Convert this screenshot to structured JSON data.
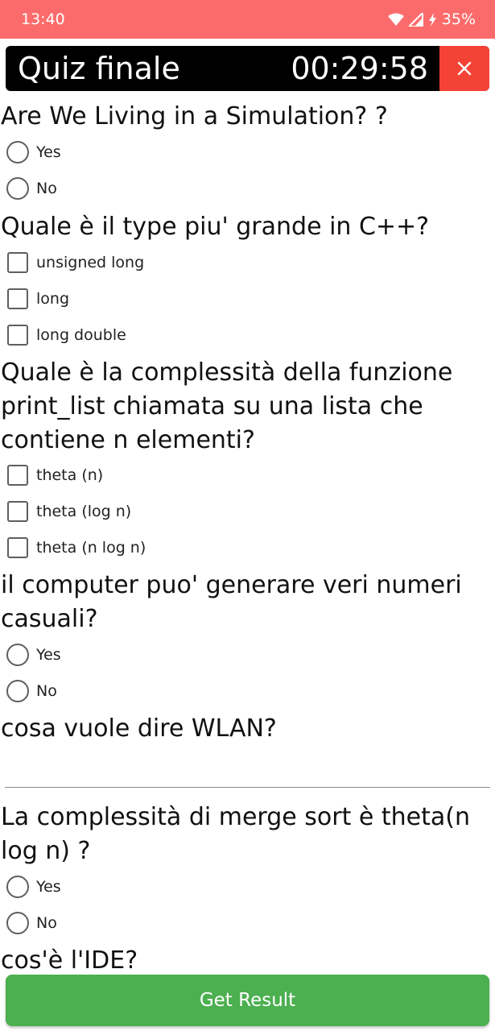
{
  "status_bar": {
    "time": "13:40",
    "battery": "35%"
  },
  "header": {
    "title": "Quiz finale",
    "timer": "00:29:58"
  },
  "questions": [
    {
      "text": "Are We Living in a Simulation? ?",
      "options": [
        "Yes",
        "No"
      ]
    },
    {
      "text": "Quale è il type piu' grande in C++?",
      "options": [
        "unsigned long",
        "long",
        "long double"
      ]
    },
    {
      "text": "Quale è la complessità della funzione print_list chiamata su una lista che contiene n elementi?",
      "options": [
        "theta (n)",
        "theta (log n)",
        "theta (n log n)"
      ]
    },
    {
      "text": "il computer puo' generare veri numeri casuali?",
      "options": [
        "Yes",
        "No"
      ]
    },
    {
      "text": "cosa vuole dire WLAN?",
      "answer": ""
    },
    {
      "text": "La complessità di merge sort è theta(n log n) ?",
      "options": [
        "Yes",
        "No"
      ]
    },
    {
      "text": "cos'è l'IDE?"
    }
  ],
  "button": {
    "label": "Get Result"
  }
}
